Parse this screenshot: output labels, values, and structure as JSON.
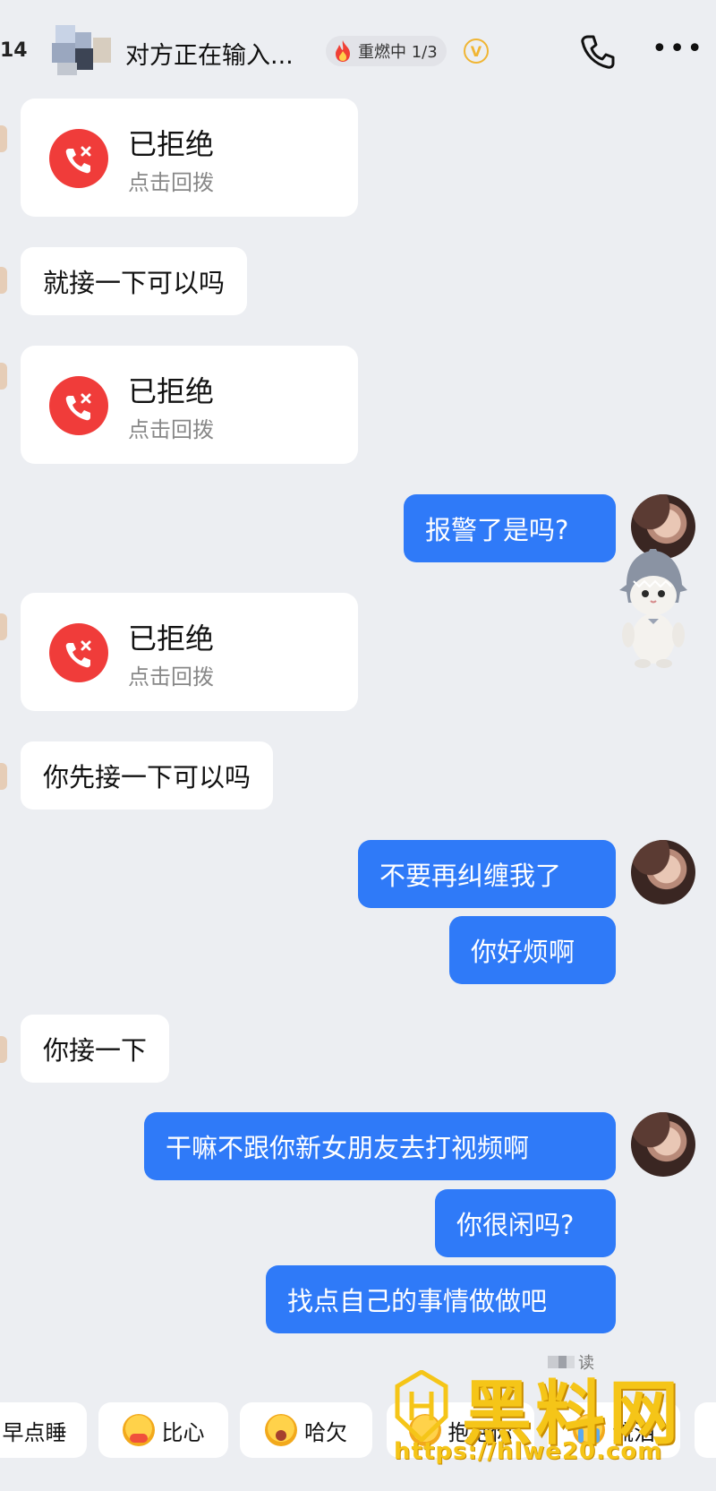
{
  "header": {
    "back_count": "14",
    "status_text": "对方正在输入...",
    "burn_label": "重燃中 1/3",
    "vip_label": "V"
  },
  "call_card": {
    "title": "已拒绝",
    "subtitle": "点击回拨"
  },
  "messages": {
    "in_1": "就接一下可以吗",
    "out_1": "报警了是吗?",
    "in_2": "你先接一下可以吗",
    "out_2": "不要再纠缠我了",
    "out_3": "你好烦啊",
    "in_3": "你接一下",
    "out_4": "干嘛不跟你新女朋友去打视频啊",
    "out_5": "你很闲吗?",
    "out_6": "找点自己的事情做做吧"
  },
  "read_label": "读",
  "quick_replies": [
    "早点睡",
    "比心",
    "哈欠",
    "抱抱你",
    "流泪"
  ],
  "watermark": {
    "brand": "黑料网",
    "url": "https://hlwe20.com"
  },
  "colors": {
    "outgoing_bubble": "#2f7af8",
    "missed_call": "#f03c3a",
    "background": "#eceef2",
    "watermark": "#f5c518"
  }
}
